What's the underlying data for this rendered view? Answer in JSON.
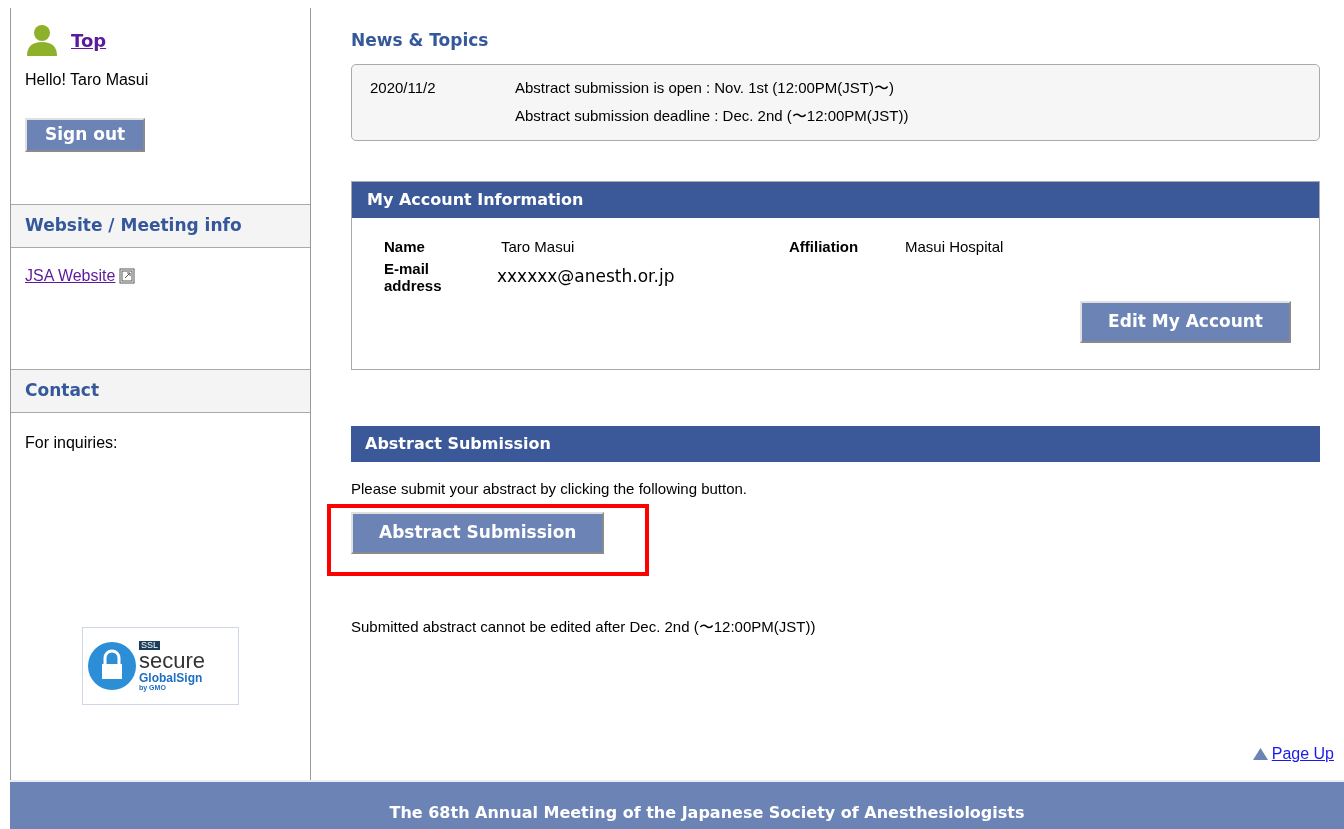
{
  "sidebar": {
    "top_link": "Top",
    "greeting": "Hello! Taro Masui",
    "sign_out": "Sign out",
    "sections": [
      {
        "title": "Website / Meeting info",
        "links": [
          {
            "label": "JSA Website",
            "external": true
          }
        ]
      },
      {
        "title": "Contact",
        "text": "For inquiries:"
      }
    ],
    "badge": {
      "ssl": "SSL",
      "secure": "secure",
      "brand": "GlobalSign",
      "by": "by GMO"
    }
  },
  "news": {
    "title": "News & Topics",
    "items": [
      {
        "date": "2020/11/2",
        "lines": [
          "Abstract submission is open : Nov. 1st (12:00PM(JST)〜)",
          "Abstract submission deadline : Dec. 2nd (〜12:00PM(JST))"
        ]
      }
    ]
  },
  "account": {
    "title": "My Account Information",
    "fields": [
      {
        "label": "Name",
        "value": "Taro Masui"
      },
      {
        "label": "Affiliation",
        "value": "Masui Hospital"
      },
      {
        "label": "E-mail address",
        "value": "xxxxxx@anesth.or.jp"
      }
    ],
    "edit_button": "Edit My Account"
  },
  "submission": {
    "title": "Abstract Submission",
    "instruction": "Please submit your abstract by clicking the following button.",
    "button": "Abstract Submission",
    "highlighted": true,
    "note": "Submitted abstract cannot be edited after Dec. 2nd (〜12:00PM(JST))"
  },
  "page_up": "Page Up",
  "footer": "The 68th Annual Meeting of the Japanese Society of Anesthesiologists"
}
